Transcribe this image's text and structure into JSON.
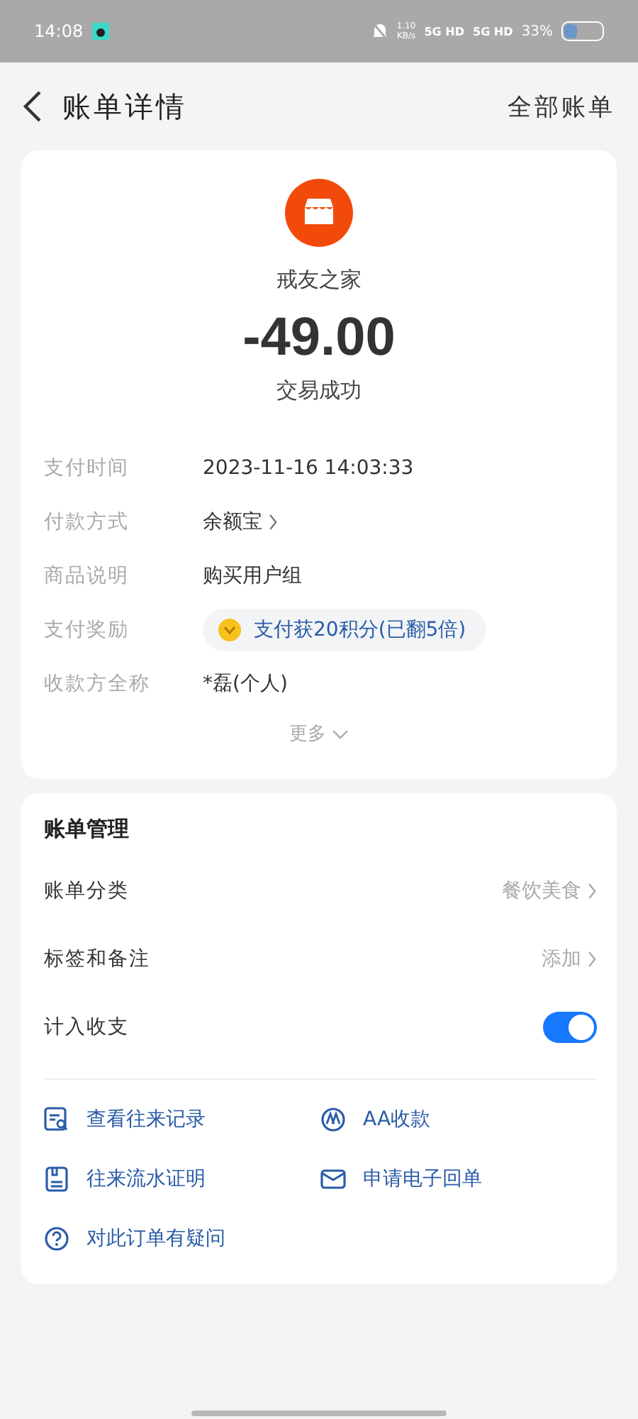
{
  "status_bar": {
    "time": "14:08",
    "speed": "1.10",
    "speed_unit": "KB/s",
    "signals": [
      "5G HD",
      "5G HD"
    ],
    "battery": "33%"
  },
  "header": {
    "title": "账单详情",
    "action": "全部账单"
  },
  "summary": {
    "merchant": "戒友之家",
    "amount": "-49.00",
    "status": "交易成功"
  },
  "details": [
    {
      "kind": "text",
      "label": "支付时间",
      "value": "2023-11-16 14:03:33"
    },
    {
      "kind": "link",
      "label": "付款方式",
      "value": "余额宝"
    },
    {
      "kind": "text",
      "label": "商品说明",
      "value": "购买用户组"
    },
    {
      "kind": "reward",
      "label": "支付奖励",
      "value": "支付获20积分(已翻5倍)"
    },
    {
      "kind": "text",
      "label": "收款方全称",
      "value": "*磊(个人)"
    }
  ],
  "more": "更多",
  "management": {
    "title": "账单管理",
    "rows": [
      {
        "kind": "link",
        "label": "账单分类",
        "value": "餐饮美食"
      },
      {
        "kind": "link",
        "label": "标签和备注",
        "value": "添加"
      },
      {
        "kind": "toggle",
        "label": "计入收支",
        "on": true
      }
    ],
    "actions": [
      "查看往来记录",
      "AA收款",
      "往来流水证明",
      "申请电子回单",
      "对此订单有疑问"
    ]
  }
}
